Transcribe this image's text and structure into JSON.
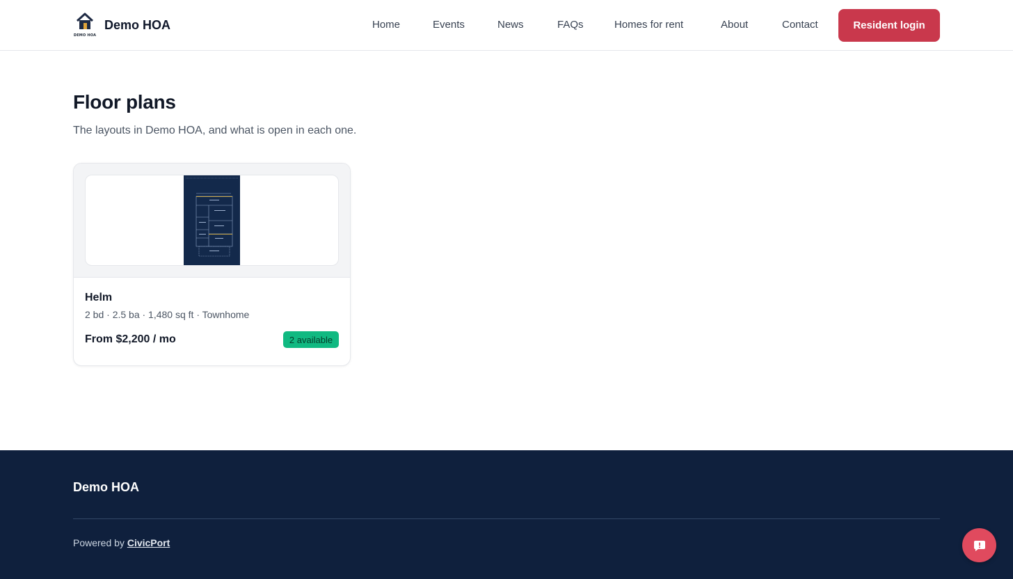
{
  "header": {
    "logo_caption": "DEMO HOA",
    "brand_name": "Demo HOA",
    "nav": [
      {
        "label": "Home"
      },
      {
        "label": "Events"
      },
      {
        "label": "News"
      },
      {
        "label": "FAQs"
      },
      {
        "label": "Homes for rent"
      },
      {
        "label": "About"
      },
      {
        "label": "Contact"
      }
    ],
    "login_label": "Resident login"
  },
  "main": {
    "title": "Floor plans",
    "subtitle": "The layouts in Demo HOA, and what is open in each one.",
    "plans": [
      {
        "name": "Helm",
        "meta": "2 bd · 2.5 ba · 1,480 sq ft · Townhome",
        "price": "From $2,200 / mo",
        "availability": "2 available"
      }
    ]
  },
  "footer": {
    "brand_name": "Demo HOA",
    "powered_prefix": "Powered by ",
    "powered_link": "CivicPort"
  },
  "colors": {
    "accent": "#c9384c",
    "footer_bg": "#0f203d",
    "badge_bg": "#10b981",
    "fab_bg": "#e04a5e"
  },
  "icons": {
    "logo": "house-icon",
    "fab": "feedback-icon"
  }
}
